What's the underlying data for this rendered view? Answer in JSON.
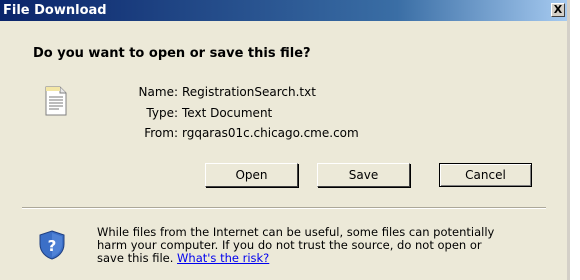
{
  "window": {
    "title": "File Download",
    "close_label": "X"
  },
  "dialog": {
    "question": "Do you want to open or save this file?",
    "file_icon": "text-file-icon",
    "info": [
      {
        "label": "Name:",
        "value": "RegistrationSearch.txt"
      },
      {
        "label": "Type:",
        "value": "Text Document"
      },
      {
        "label": "From:",
        "value": "rgqaras01c.chicago.cme.com"
      }
    ],
    "buttons": {
      "open": "Open",
      "save": "Save",
      "cancel": "Cancel"
    },
    "warning": {
      "icon": "shield-question-icon",
      "text_line1": "While files from the Internet can be useful, some files can potentially",
      "text_line2": "harm your computer. If you do not trust the source, do not open or",
      "text_line3": "save this file.",
      "link": "What's the risk?"
    }
  },
  "colors": {
    "dialog_bg": "#ece9d8",
    "titlebar_start": "#0a246a",
    "titlebar_end": "#a6caf0",
    "link": "#0000ee"
  }
}
